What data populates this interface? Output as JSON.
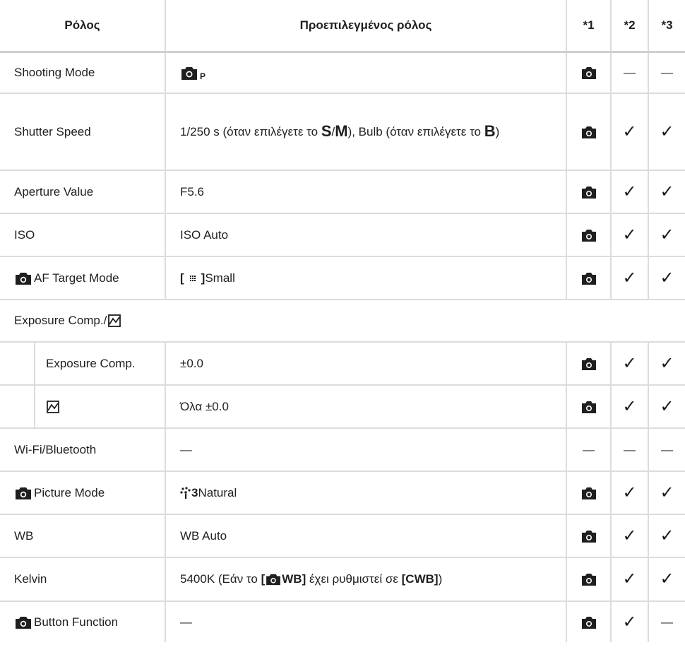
{
  "header": {
    "role": "Ρόλος",
    "default": "Προεπιλεγμένος ρόλος",
    "col1": "*1",
    "col2": "*2",
    "col3": "*3"
  },
  "rows": {
    "shooting_mode": {
      "role": "Shooting Mode",
      "default_icon": "camera-p-mode-icon",
      "c1": "camera-icon",
      "c2": "—",
      "c3": "—"
    },
    "shutter_speed": {
      "role": "Shutter Speed",
      "default_text_1": "1/250 s (όταν επιλέγετε το ",
      "mode_s": "S",
      "slash": "/",
      "mode_m": "M",
      "default_text_2": "), Bulb (όταν επιλέγετε το ",
      "mode_b": "B",
      "default_text_3": ")",
      "c1": "camera-icon",
      "c2": "✓",
      "c3": "✓"
    },
    "aperture": {
      "role": "Aperture Value",
      "default": "F5.6",
      "c2": "✓",
      "c3": "✓"
    },
    "iso": {
      "role": "ISO",
      "default": "ISO Auto",
      "c2": "✓",
      "c3": "✓"
    },
    "af_target": {
      "role": "AF Target Mode",
      "bracket_open": "[",
      "bracket_close": "]",
      "default": "Small",
      "c2": "✓",
      "c3": "✓"
    },
    "exposure_group": {
      "role": "Exposure Comp./"
    },
    "exposure_comp": {
      "role": "Exposure Comp.",
      "default": "±0.0",
      "c2": "✓",
      "c3": "✓"
    },
    "highlight_shadow": {
      "role_icon": "highlight-shadow-icon",
      "default": "Όλα ±0.0",
      "c2": "✓",
      "c3": "✓"
    },
    "wifi": {
      "role": "Wi-Fi/Bluetooth",
      "default": "—",
      "c1": "—",
      "c2": "—",
      "c3": "—"
    },
    "picture_mode": {
      "role": "Picture Mode",
      "pm_number": "3",
      "default": "Natural",
      "c2": "✓",
      "c3": "✓"
    },
    "wb": {
      "role": "WB",
      "default": "WB Auto",
      "c2": "✓",
      "c3": "✓"
    },
    "kelvin": {
      "role": "Kelvin",
      "text_1": "5400K (Εάν το ",
      "bracket_open": "[",
      "wb_label": "WB]",
      "text_2": " έχει ρυθμιστεί σε ",
      "cwb": "[CWB]",
      "text_3": ")",
      "c2": "✓",
      "c3": "✓"
    },
    "button_function": {
      "role": "Button Function",
      "default": "—",
      "c2": "✓",
      "c3": "—"
    }
  },
  "colors": {
    "border": "#dcdcdc",
    "text": "#1f1f1f"
  }
}
